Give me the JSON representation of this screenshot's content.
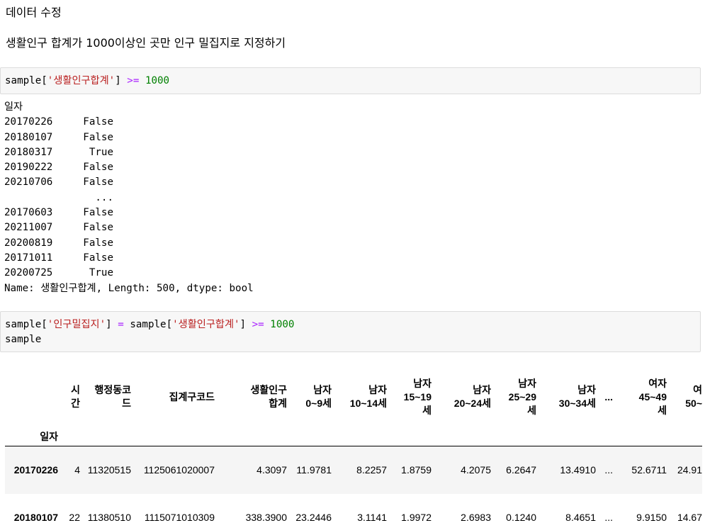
{
  "markdown": {
    "heading": "데이터 수정",
    "description": "생활인구 합계가 1000이상인 곳만 인구 밀집지로 지정하기"
  },
  "cell1": {
    "code_prefix": "sample[",
    "code_str": "'생활인구합계'",
    "code_mid": "] ",
    "code_op": ">=",
    "code_sp": " ",
    "code_num": "1000"
  },
  "output1": {
    "index_name": "일자",
    "rows": [
      {
        "idx": "20170226",
        "val": "False"
      },
      {
        "idx": "20180107",
        "val": "False"
      },
      {
        "idx": "20180317",
        "val": "True"
      },
      {
        "idx": "20190222",
        "val": "False"
      },
      {
        "idx": "20210706",
        "val": "False"
      },
      {
        "idx": "",
        "val": "..."
      },
      {
        "idx": "20170603",
        "val": "False"
      },
      {
        "idx": "20211007",
        "val": "False"
      },
      {
        "idx": "20200819",
        "val": "False"
      },
      {
        "idx": "20171011",
        "val": "False"
      },
      {
        "idx": "20200725",
        "val": "True"
      }
    ],
    "footer": "Name: 생활인구합계, Length: 500, dtype: bool"
  },
  "cell2": {
    "l1_prefix": "sample[",
    "l1_str1": "'인구밀집지'",
    "l1_mid1": "] ",
    "l1_op1": "=",
    "l1_mid2": " sample[",
    "l1_str2": "'생활인구합계'",
    "l1_mid3": "] ",
    "l1_op2": ">=",
    "l1_sp": " ",
    "l1_num": "1000",
    "line2": "sample"
  },
  "dataframe": {
    "index_label": "일자",
    "columns": [
      {
        "l1": "시",
        "l2": "간",
        "l3": ""
      },
      {
        "l1": "행정동코",
        "l2": "드",
        "l3": ""
      },
      {
        "l1": "집계구코드",
        "l2": "",
        "l3": ""
      },
      {
        "l1": "생활인구",
        "l2": "합계",
        "l3": ""
      },
      {
        "l1": "남자",
        "l2": "0~9세",
        "l3": ""
      },
      {
        "l1": "남자",
        "l2": "10~14세",
        "l3": ""
      },
      {
        "l1": "남자",
        "l2": "15~19",
        "l3": "세"
      },
      {
        "l1": "남자",
        "l2": "20~24세",
        "l3": ""
      },
      {
        "l1": "남자",
        "l2": "25~29",
        "l3": "세"
      },
      {
        "l1": "남자",
        "l2": "30~34세",
        "l3": ""
      },
      {
        "l1": "...",
        "l2": "",
        "l3": ""
      },
      {
        "l1": "여자",
        "l2": "45~49",
        "l3": "세"
      },
      {
        "l1": "여",
        "l2": "50~",
        "l3": ""
      }
    ],
    "rows": [
      {
        "idx": "20170226",
        "cells": [
          "4",
          "11320515",
          "1125061020007",
          "4.3097",
          "11.9781",
          "8.2257",
          "1.8759",
          "4.2075",
          "6.2647",
          "13.4910",
          "...",
          "52.6711",
          "24.91"
        ]
      },
      {
        "idx": "20180107",
        "cells": [
          "22",
          "11380510",
          "1115071010309",
          "338.3900",
          "23.2446",
          "3.1141",
          "1.9972",
          "2.6983",
          "0.1240",
          "8.4651",
          "...",
          "9.9150",
          "14.67"
        ]
      }
    ]
  }
}
